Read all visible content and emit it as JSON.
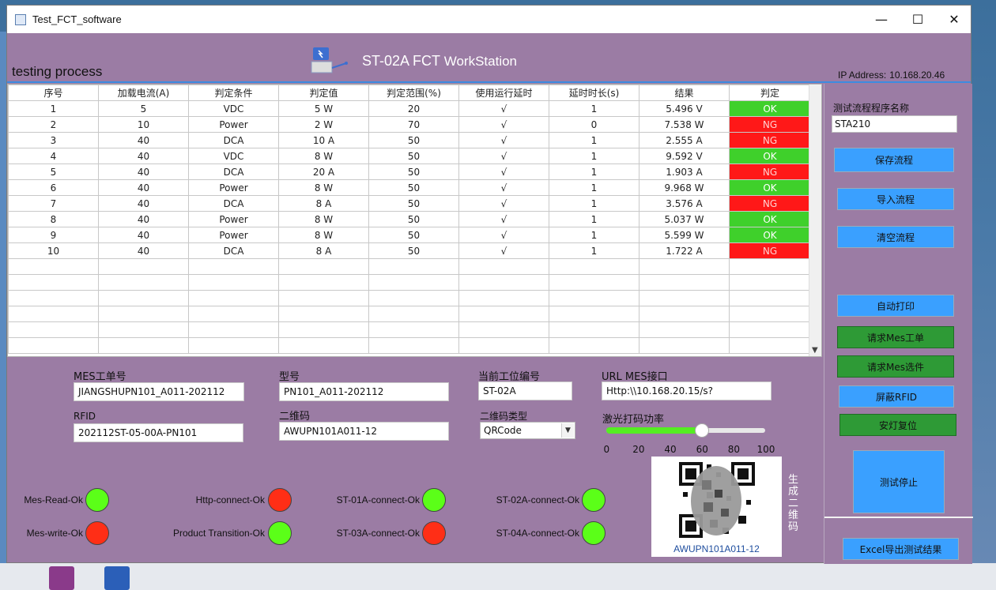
{
  "window": {
    "title": "Test_FCT_software"
  },
  "header": {
    "section_title": "testing process",
    "station_title_a": "ST-02A  FCT",
    "station_title_b": "WorkStation",
    "ip_label": "IP Address:",
    "ip_value": "10.168.20.46"
  },
  "table": {
    "columns": [
      "序号",
      "加载电流(A)",
      "判定条件",
      "判定值",
      "判定范围(%)",
      "使用运行延时",
      "延时时长(s)",
      "结果",
      "判定"
    ],
    "rows": [
      [
        "1",
        "5",
        "VDC",
        "5 W",
        "20",
        "√",
        "1",
        "5.496 V",
        "OK"
      ],
      [
        "2",
        "10",
        "Power",
        "2 W",
        "70",
        "√",
        "0",
        "7.538 W",
        "NG"
      ],
      [
        "3",
        "40",
        "DCA",
        "10 A",
        "50",
        "√",
        "1",
        "2.555 A",
        "NG"
      ],
      [
        "4",
        "40",
        "VDC",
        "8 W",
        "50",
        "√",
        "1",
        "9.592 V",
        "OK"
      ],
      [
        "5",
        "40",
        "DCA",
        "20 A",
        "50",
        "√",
        "1",
        "1.903 A",
        "NG"
      ],
      [
        "6",
        "40",
        "Power",
        "8 W",
        "50",
        "√",
        "1",
        "9.968 W",
        "OK"
      ],
      [
        "7",
        "40",
        "DCA",
        "8 A",
        "50",
        "√",
        "1",
        "3.576 A",
        "NG"
      ],
      [
        "8",
        "40",
        "Power",
        "8 W",
        "50",
        "√",
        "1",
        "5.037 W",
        "OK"
      ],
      [
        "9",
        "40",
        "Power",
        "8 W",
        "50",
        "√",
        "1",
        "5.599 W",
        "OK"
      ],
      [
        "10",
        "40",
        "DCA",
        "8 A",
        "50",
        "√",
        "1",
        "1.722 A",
        "NG"
      ]
    ],
    "empty_rows": 6
  },
  "right_panel": {
    "program_label": "测试流程程序名称",
    "program_value": "STA210",
    "save_flow": "保存流程",
    "import_flow": "导入流程",
    "clear_flow": "清空流程",
    "auto_print": "自动打印",
    "request_mes_order": "请求Mes工单",
    "request_mes_option": "请求Mes选件",
    "mask_rfid": "屏蔽RFID",
    "safety_light_reset": "安灯复位",
    "stop_test": "测试停止",
    "export_excel": "Excel导出测试结果"
  },
  "form": {
    "mes_order_label": "MES工单号",
    "mes_order_value": "JIANGSHUPN101_A011-202112",
    "model_label": "型号",
    "model_value": "PN101_A011-202112",
    "station_code_label": "当前工位编号",
    "station_code_value": "ST-02A",
    "url_label": "URL MES接口",
    "url_value": "Http:\\\\10.168.20.15/s?",
    "rfid_label": "RFID",
    "rfid_value": "202112ST-05-00A-PN101",
    "qrcode_label": "二维码",
    "qrcode_value": "AWUPN101A011-12",
    "qr_type_label": "二维码类型",
    "qr_type_value": "QRCode",
    "laser_label": "激光打码功率",
    "laser_value": 60,
    "laser_ticks": [
      "0",
      "20",
      "40",
      "60",
      "80",
      "100"
    ],
    "qr_caption": "AWUPN101A011-12",
    "generate_qr": "生成二维码"
  },
  "status": [
    {
      "label": "Mes-Read-Ok",
      "state": "green"
    },
    {
      "label": "Http-connect-Ok",
      "state": "red"
    },
    {
      "label": "ST-01A-connect-Ok",
      "state": "green"
    },
    {
      "label": "ST-02A-connect-Ok",
      "state": "green"
    },
    {
      "label": "Mes-write-Ok",
      "state": "red"
    },
    {
      "label": "Product Transition-Ok",
      "state": "green"
    },
    {
      "label": "ST-03A-connect-Ok",
      "state": "red"
    },
    {
      "label": "ST-04A-connect-Ok",
      "state": "green"
    }
  ],
  "colors": {
    "ok": "#3fd02b",
    "ng": "#ff1818",
    "panel": "#9b7ca4",
    "button_blue": "#3aa0ff",
    "button_green": "#2e9a36"
  }
}
